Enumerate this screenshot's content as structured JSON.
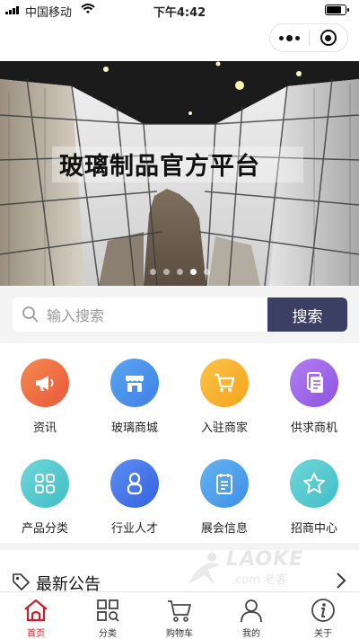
{
  "status_bar": {
    "carrier": "中国移动",
    "time": "下午4:42",
    "battery_level": 0.85
  },
  "capsule": {
    "more_icon": "more-dots-icon",
    "close_icon": "target-circle-icon"
  },
  "banner": {
    "title": "玻璃制品官方平台",
    "slide_count": 5,
    "active_slide": 4
  },
  "search": {
    "placeholder": "输入搜索",
    "button_label": "搜索"
  },
  "categories": [
    {
      "label": "资讯",
      "icon": "megaphone-icon",
      "color_start": "#f58a4f",
      "color_end": "#e9573a"
    },
    {
      "label": "玻璃商城",
      "icon": "store-icon",
      "color_start": "#5aa6f2",
      "color_end": "#3e81e6"
    },
    {
      "label": "入驻商家",
      "icon": "cart-icon",
      "color_start": "#fbc44a",
      "color_end": "#f6a319"
    },
    {
      "label": "供求商机",
      "icon": "document-icon",
      "color_start": "#b27ff0",
      "color_end": "#8c52e0"
    },
    {
      "label": "产品分类",
      "icon": "grid-icon",
      "color_start": "#6fd8d8",
      "color_end": "#41bdc7"
    },
    {
      "label": "行业人才",
      "icon": "person-icon",
      "color_start": "#5c8ff2",
      "color_end": "#3560df"
    },
    {
      "label": "展会信息",
      "icon": "calendar-icon",
      "color_start": "#64b3f3",
      "color_end": "#3e8fe6"
    },
    {
      "label": "招商中心",
      "icon": "star-icon",
      "color_start": "#6fd8d8",
      "color_end": "#41bdc7"
    }
  ],
  "notice": {
    "title": "最新公告",
    "icon": "tag-icon",
    "arrow_icon": "chevron-right-icon"
  },
  "watermark": {
    "line1": "LAOKE",
    "line2": ".com 老客"
  },
  "tabbar": {
    "active_color": "#c8202c",
    "items": [
      {
        "label": "首页",
        "icon": "home-icon"
      },
      {
        "label": "分类",
        "icon": "category-icon"
      },
      {
        "label": "购物车",
        "icon": "cart-icon"
      },
      {
        "label": "我的",
        "icon": "user-icon"
      },
      {
        "label": "关于",
        "icon": "info-icon"
      }
    ]
  }
}
